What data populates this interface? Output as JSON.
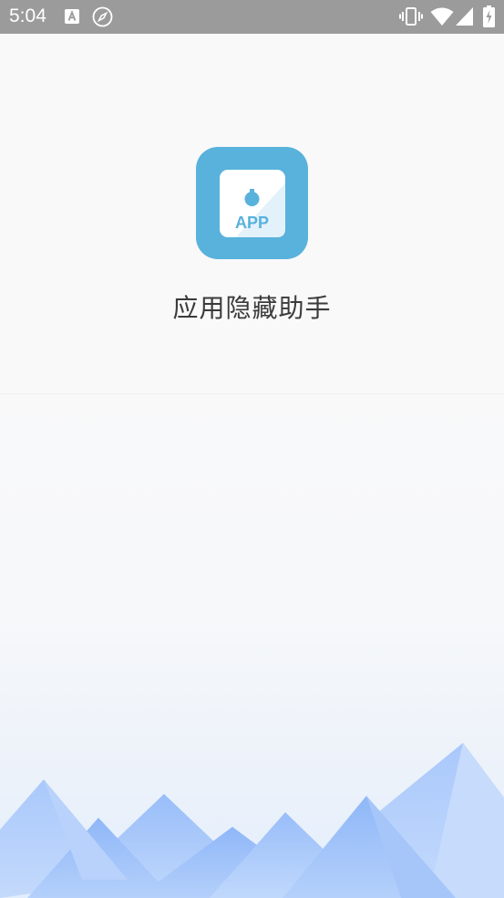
{
  "status_bar": {
    "time": "5:04",
    "a_icon_letter": "A",
    "icons": [
      "a-notification-icon",
      "compass-icon",
      "vibrate-icon",
      "wifi-icon",
      "signal-icon",
      "battery-icon"
    ]
  },
  "splash": {
    "app_name": "应用隐藏助手",
    "logo_text": "APP",
    "logo_color": "#58b2dc"
  }
}
